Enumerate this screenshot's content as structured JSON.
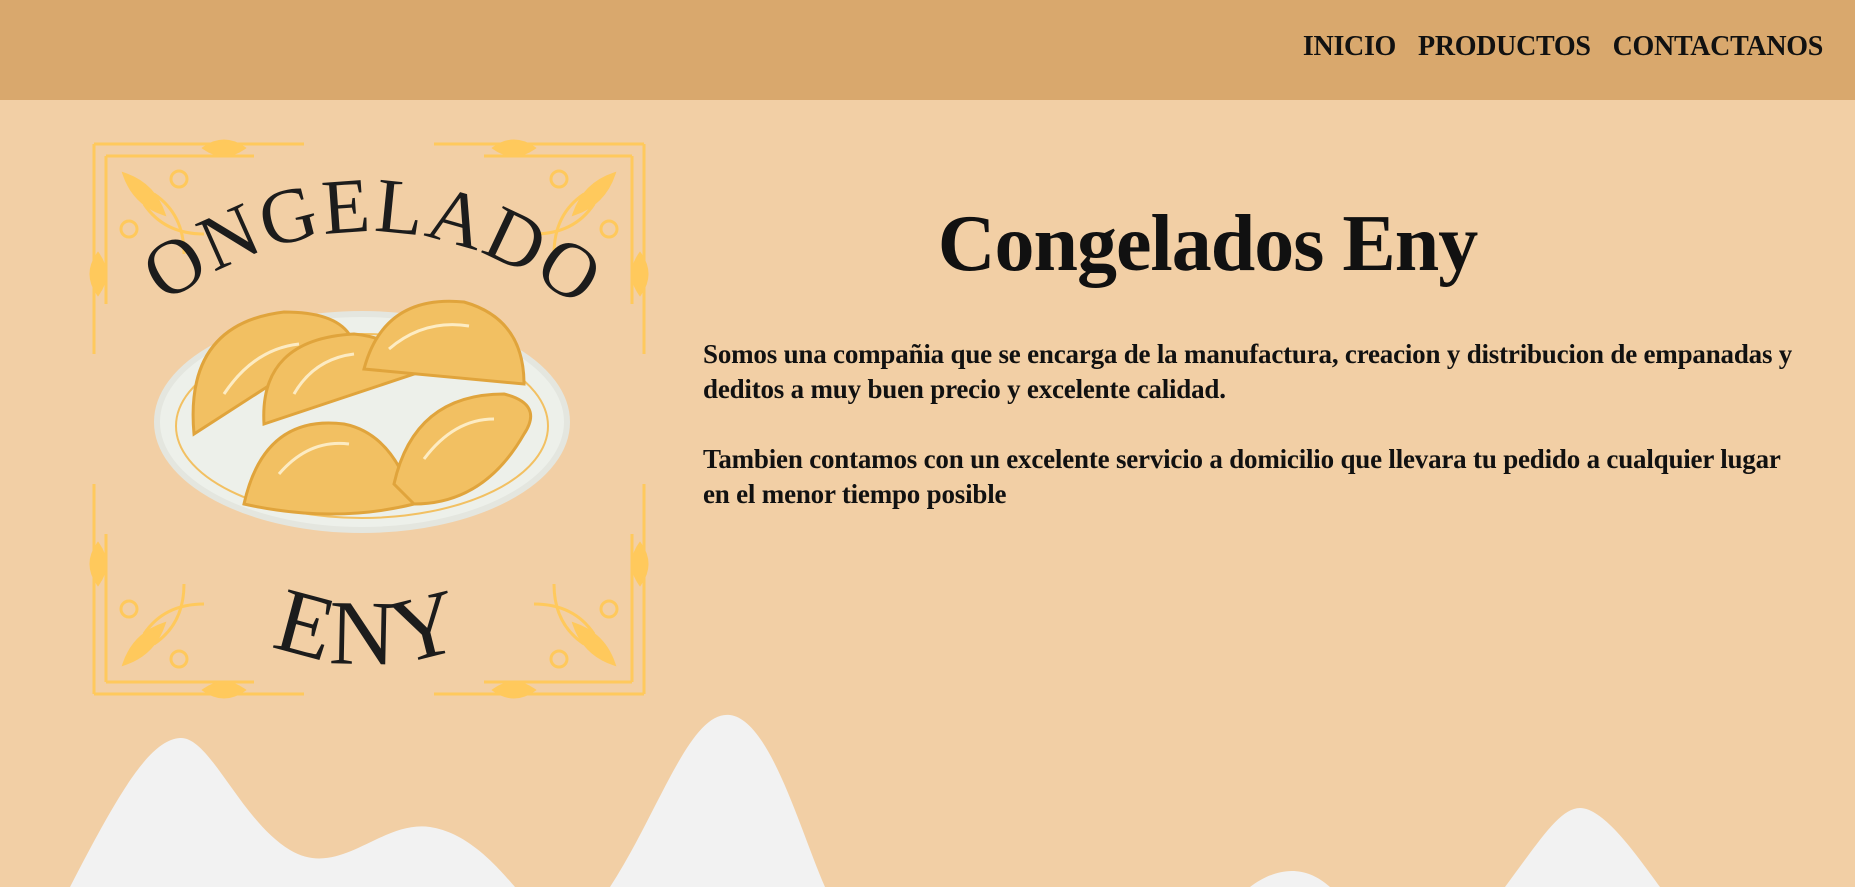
{
  "nav": {
    "items": [
      {
        "label": "INICIO"
      },
      {
        "label": "PRODUCTOS"
      },
      {
        "label": "CONTACTANOS"
      }
    ]
  },
  "logo": {
    "top_text": "CONGELADOS",
    "bottom_text": "ENY"
  },
  "hero": {
    "title": "Congelados Eny",
    "paragraphs": [
      "Somos una compañia que se encarga de la manufactura, creacion y distribucion de empanadas y deditos a muy buen precio y excelente calidad.",
      "Tambien contamos con un excelente servicio a domicilio que llevara tu pedido a cualquier lugar en el menor tiempo posible"
    ]
  },
  "colors": {
    "header": "#d9a86d",
    "background": "#f2cfa5",
    "ornament": "#ffc95c",
    "empanada": "#f2c062",
    "wave": "#f2f2f2"
  }
}
